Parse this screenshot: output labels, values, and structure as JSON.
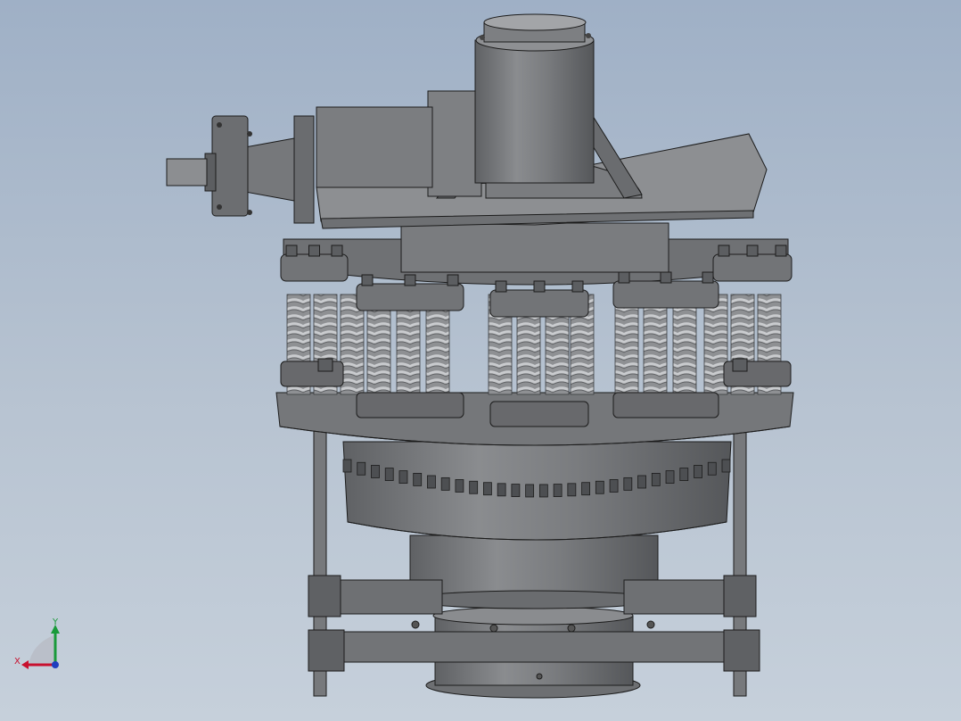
{
  "viewport": {
    "background_top": "#9fb0c6",
    "background_bottom": "#c6d0db"
  },
  "model": {
    "description_icon": "cone-crusher-assembly-icon",
    "body_color": "#7d7f82",
    "shadow_color": "#5a5c5f",
    "highlight_color": "#a4a6a9",
    "edge_color": "#1c1c1c",
    "spring_color": "#b5b7ba"
  },
  "triad": {
    "x_label": "X",
    "y_label": "Y",
    "x_color": "#c8102e",
    "y_color": "#1a9a3a",
    "z_color": "#1f3fbf"
  }
}
